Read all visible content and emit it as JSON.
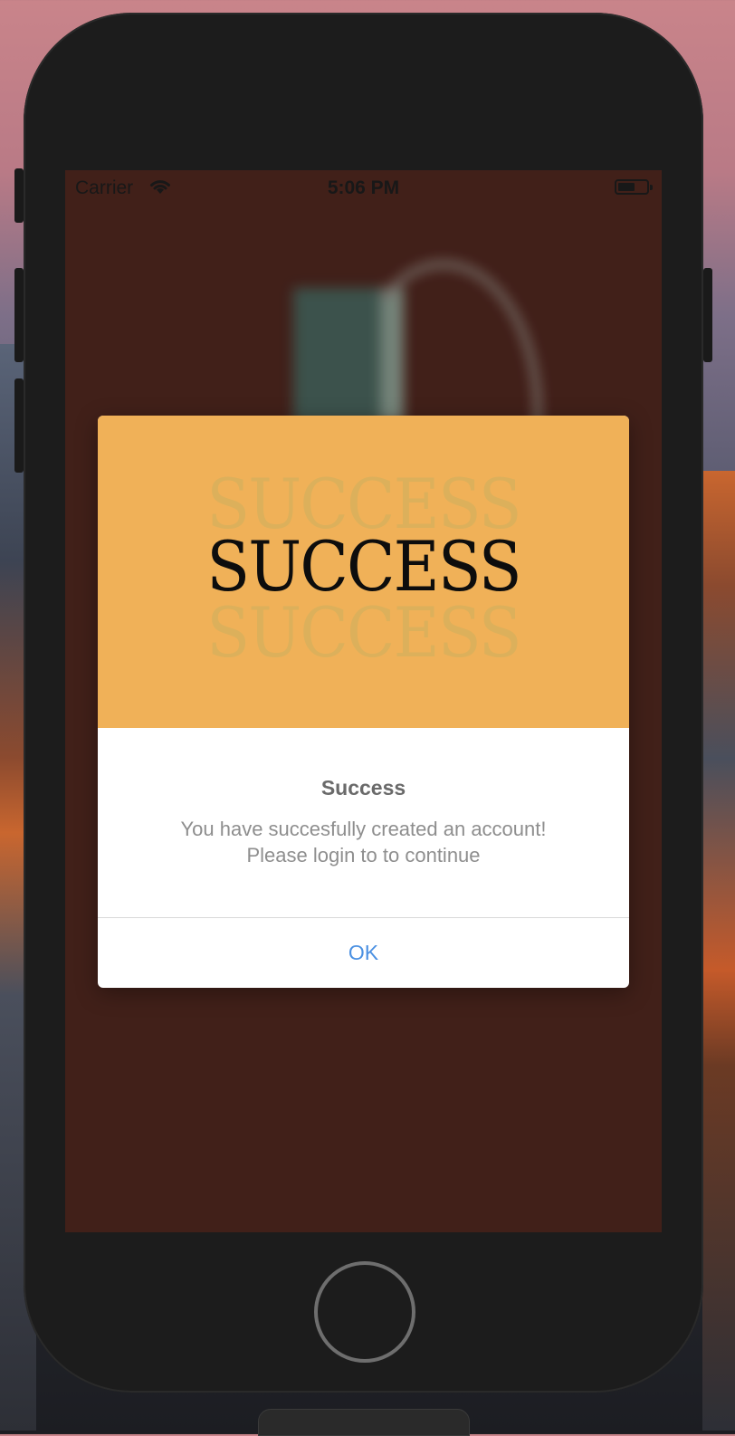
{
  "status_bar": {
    "carrier": "Carrier",
    "time": "5:06 PM"
  },
  "alert": {
    "banner_word": "SUCCESS",
    "banner_color": "#f0b158",
    "title": "Success",
    "message_line1": "You have succesfully created an account!",
    "message_line2": "Please login to to continue",
    "ok_label": "OK",
    "ok_color": "#4a90e2"
  },
  "screen_background": "#46221b",
  "icons": [
    "wifi-icon",
    "battery-icon",
    "home-button"
  ]
}
